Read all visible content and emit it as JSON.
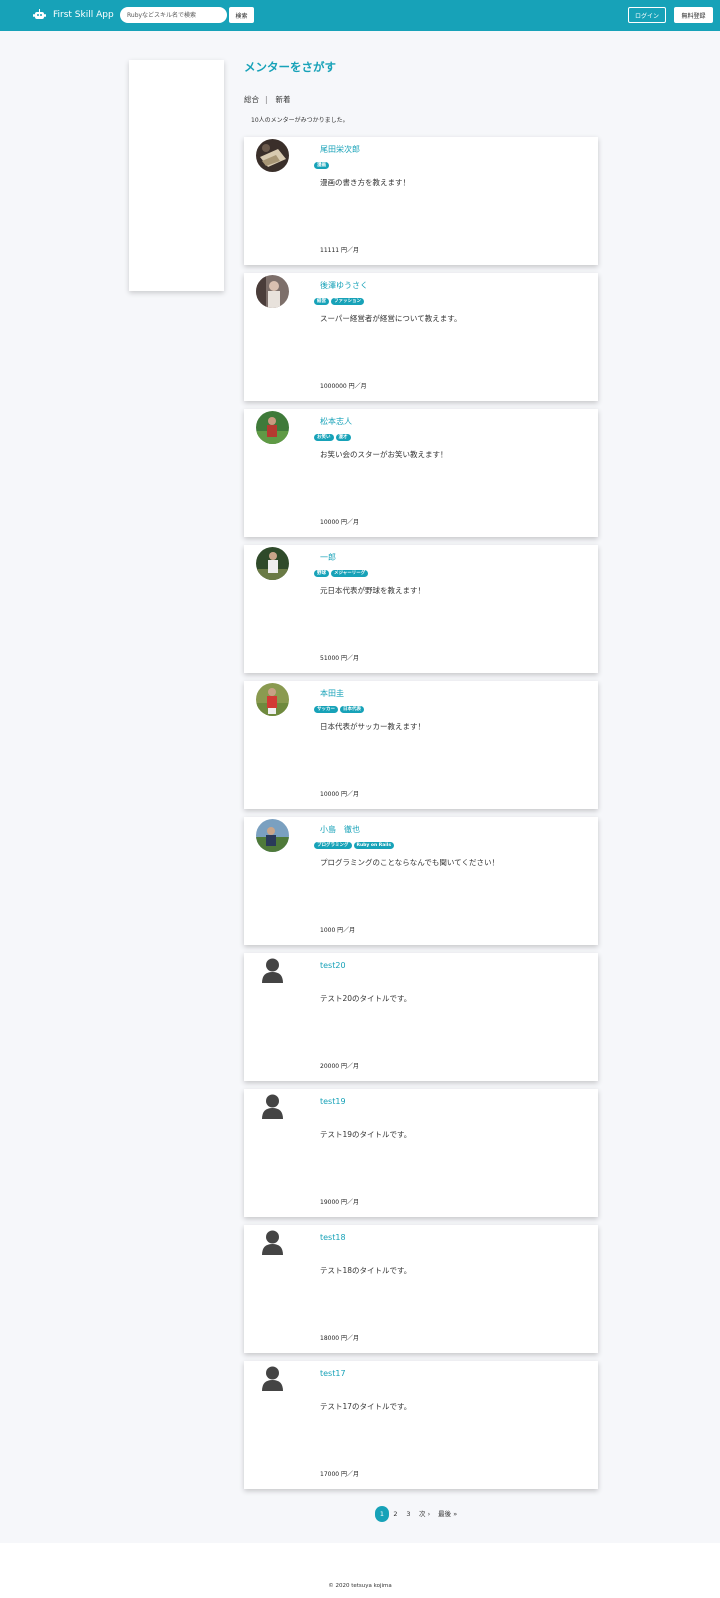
{
  "header": {
    "app_title": "First Skill App",
    "search_placeholder": "Rubyなどスキル名で検索",
    "search_button": "検索",
    "login_button": "ログイン",
    "signup_button": "無料登録",
    "brand_color": "#17a2b8"
  },
  "main": {
    "page_title": "メンターをさがす",
    "sort_tabs": [
      "総合",
      "新着"
    ],
    "sort_separator": "|",
    "results_count": "10人のメンターがみつかりました。"
  },
  "mentors": [
    {
      "name": "尾田栄次郎",
      "tags": [
        "漫画"
      ],
      "title": "漫画の書き方を教えます！",
      "price": "11111 円／月",
      "avatar": "photo"
    },
    {
      "name": "後澤ゆうさく",
      "tags": [
        "経営",
        "ファッション"
      ],
      "title": "スーパー経営者が経営について教えます。",
      "price": "1000000 円／月",
      "avatar": "photo"
    },
    {
      "name": "松本志人",
      "tags": [
        "お笑い",
        "漫才"
      ],
      "title": "お笑い会のスターがお笑い教えます！",
      "price": "10000 円／月",
      "avatar": "photo"
    },
    {
      "name": "一郎",
      "tags": [
        "野球",
        "メジャーリーグ"
      ],
      "title": "元日本代表が野球を教えます！",
      "price": "51000 円／月",
      "avatar": "photo"
    },
    {
      "name": "本田圭",
      "tags": [
        "サッカー",
        "日本代表"
      ],
      "title": "日本代表がサッカー教えます！",
      "price": "10000 円／月",
      "avatar": "photo"
    },
    {
      "name": "小島　徹也",
      "tags": [
        "プログラミング",
        "Ruby on Rails"
      ],
      "title": "プログラミングのことならなんでも聞いてください！",
      "price": "1000 円／月",
      "avatar": "photo"
    },
    {
      "name": "test20",
      "tags": [],
      "title": "テスト20のタイトルです。",
      "price": "20000 円／月",
      "avatar": "default"
    },
    {
      "name": "test19",
      "tags": [],
      "title": "テスト19のタイトルです。",
      "price": "19000 円／月",
      "avatar": "default"
    },
    {
      "name": "test18",
      "tags": [],
      "title": "テスト18のタイトルです。",
      "price": "18000 円／月",
      "avatar": "default"
    },
    {
      "name": "test17",
      "tags": [],
      "title": "テスト17のタイトルです。",
      "price": "17000 円／月",
      "avatar": "default"
    }
  ],
  "pagination": {
    "pages": [
      "1",
      "2",
      "3"
    ],
    "current": "1",
    "next": "次 ›",
    "last": "最後 »"
  },
  "footer": {
    "copyright": "© 2020 tetsuya kojima"
  }
}
